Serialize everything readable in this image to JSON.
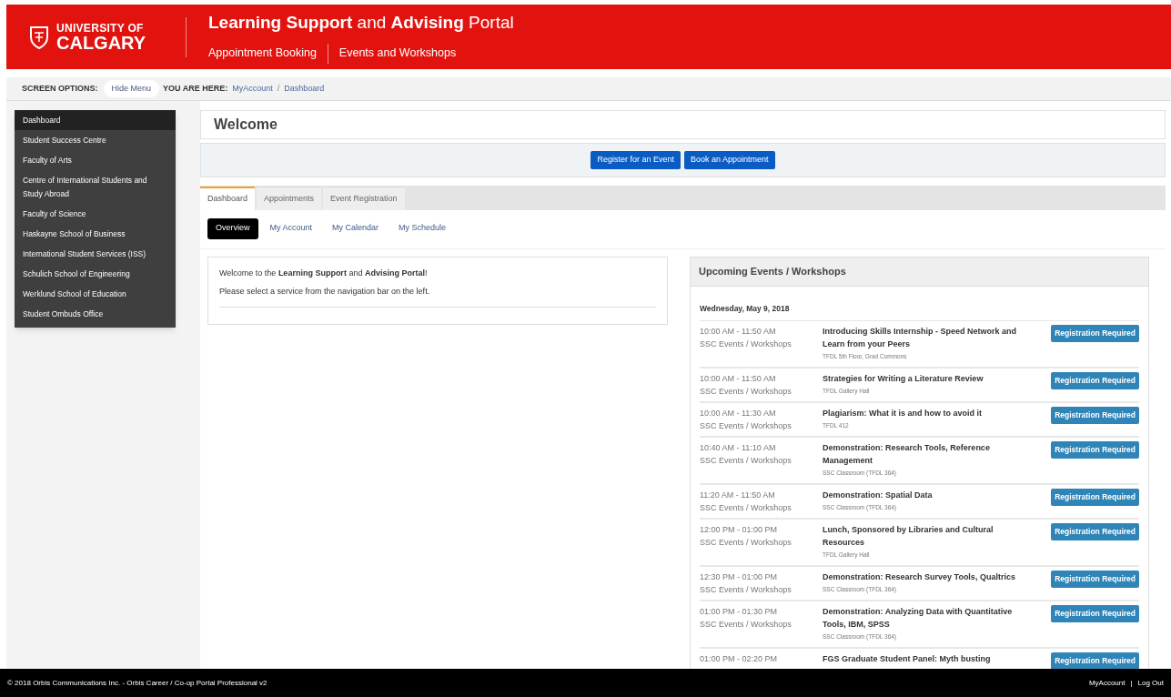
{
  "header": {
    "logo_line1": "UNIVERSITY OF",
    "logo_line2": "CALGARY",
    "title": "**Learning Support** and **Advising** Portal",
    "nav": [
      {
        "label": "Appointment Booking"
      },
      {
        "label": "Events and Workshops"
      }
    ]
  },
  "screen_options": {
    "label": "SCREEN OPTIONS:",
    "button": "Hide Menu",
    "here_label": "YOU ARE HERE:",
    "breadcrumb": [
      "MyAccount",
      "Dashboard"
    ],
    "separator": "/"
  },
  "sidebar": {
    "items": [
      {
        "label": "Dashboard",
        "selected": true
      },
      {
        "label": "Student Success Centre",
        "selected": false
      },
      {
        "label": "Faculty of Arts",
        "selected": false
      },
      {
        "label": "Centre of International Students and Study Abroad",
        "selected": false
      },
      {
        "label": "Faculty of Science",
        "selected": false
      },
      {
        "label": "Haskayne School of Business",
        "selected": false
      },
      {
        "label": "International Student Services (ISS)",
        "selected": false
      },
      {
        "label": "Schulich School of Engineering",
        "selected": false
      },
      {
        "label": "Werklund School of Education",
        "selected": false
      },
      {
        "label": "Student Ombuds Office",
        "selected": false
      }
    ]
  },
  "page_title": "Welcome",
  "actions": [
    "Register for an Event",
    "Book an Appointment"
  ],
  "tabs": [
    {
      "label": "Dashboard",
      "selected": true
    },
    {
      "label": "Appointments",
      "selected": false
    },
    {
      "label": "Event Registration",
      "selected": false
    }
  ],
  "subtabs": [
    {
      "label": "Overview",
      "selected": true
    },
    {
      "label": "My Account",
      "selected": false
    },
    {
      "label": "My Calendar",
      "selected": false
    },
    {
      "label": "My Schedule",
      "selected": false
    }
  ],
  "welcome": {
    "line1": "Welcome to the **Learning Support** and **Advising Portal**!",
    "line2": "Please select a service from the navigation bar on the left."
  },
  "events": {
    "title": "Upcoming Events / Workshops",
    "date": "Wednesday, May 9, 2018",
    "rows": [
      {
        "time": "10:00 AM - 11:50 AM",
        "category": "SSC Events / Workshops",
        "title": "Introducing Skills Internship - Speed Network and Learn from your Peers",
        "location": "TFDL 5th Floor, Grad Commons",
        "button": "Registration Required"
      },
      {
        "time": "10:00 AM - 11:50 AM",
        "category": "SSC Events / Workshops",
        "title": "Strategies for Writing a Literature Review",
        "location": "TFDL Gallery Hall",
        "button": "Registration Required"
      },
      {
        "time": "10:00 AM - 11:30 AM",
        "category": "SSC Events / Workshops",
        "title": "Plagiarism: What it is and how to avoid it",
        "location": "TFDL 412",
        "button": "Registration Required"
      },
      {
        "time": "10:40 AM - 11:10 AM",
        "category": "SSC Events / Workshops",
        "title": "Demonstration: Research Tools, Reference Management",
        "location": "SSC Classroom (TFDL 364)",
        "button": "Registration Required"
      },
      {
        "time": "11:20 AM - 11:50 AM",
        "category": "SSC Events / Workshops",
        "title": "Demonstration: Spatial Data",
        "location": "SSC Classroom (TFDL 364)",
        "button": "Registration Required"
      },
      {
        "time": "12:00 PM - 01:00 PM",
        "category": "SSC Events / Workshops",
        "title": "Lunch, Sponsored by Libraries and Cultural Resources",
        "location": "TFDL Gallery Hall",
        "button": "Registration Required"
      },
      {
        "time": "12:30 PM - 01:00 PM",
        "category": "SSC Events / Workshops",
        "title": "Demonstration: Research Survey Tools, Qualtrics",
        "location": "SSC Classroom (TFDL 364)",
        "button": "Registration Required"
      },
      {
        "time": "01:00 PM - 01:30 PM",
        "category": "SSC Events / Workshops",
        "title": "Demonstration: Analyzing Data with Quantitative Tools, IBM, SPSS",
        "location": "SSC Classroom (TFDL 364)",
        "button": "Registration Required"
      },
      {
        "time": "01:00 PM - 02:20 PM",
        "title": "FGS Graduate Student Panel: Myth busting",
        "button": "Registration Required"
      }
    ]
  },
  "footer": {
    "copyright": "© 2018 Orbis Communications Inc. - Orbis Career / Co-op Portal Professional v2",
    "links": [
      "MyAccount",
      "Log Out"
    ],
    "separator": "|"
  }
}
